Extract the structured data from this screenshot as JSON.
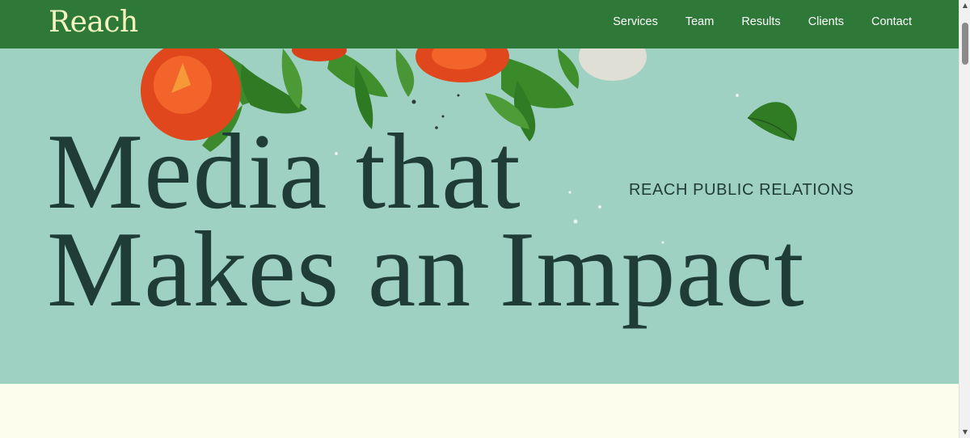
{
  "header": {
    "logo": "Reach",
    "nav": [
      "Services",
      "Team",
      "Results",
      "Clients",
      "Contact"
    ]
  },
  "hero": {
    "headline_line1": "Media that",
    "headline_line2": "Makes an Impact",
    "eyebrow": "REACH PUBLIC RELATIONS",
    "image_subject": "cherry tomatoes and arugula salad on teal background"
  },
  "colors": {
    "header_bg": "#2e7838",
    "logo": "#f4f4c0",
    "hero_bg": "#9fd1c3",
    "headline": "#1f3d36",
    "page_bg": "#fdfdee"
  },
  "scrollbar": {
    "up_icon": "chevron-up-icon",
    "down_icon": "chevron-down-icon"
  }
}
